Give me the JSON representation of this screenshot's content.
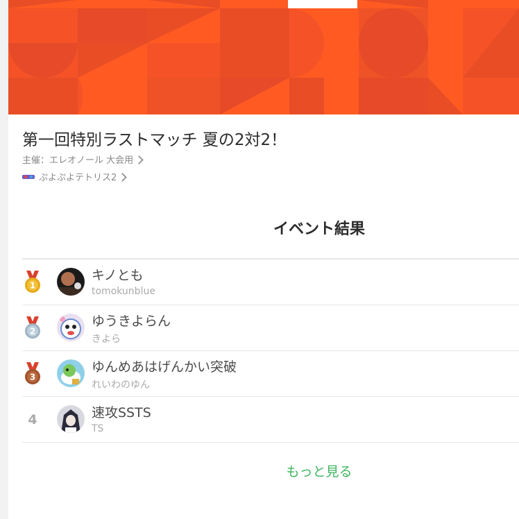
{
  "event": {
    "title": "第一回特別ラストマッチ 夏の2対2！",
    "organizer": "主催：エレオノール 大会用",
    "game": "ぷよぷよテトリス2"
  },
  "results": {
    "heading": "イベント結果",
    "entries": [
      {
        "rank": "1",
        "team": "キノとも",
        "members": "tomokunblue",
        "medal": "gold-medal-icon",
        "medal_color": "#e6a817"
      },
      {
        "rank": "2",
        "team": "ゆうきよらん",
        "members": "きよら",
        "medal": "silver-medal-icon",
        "medal_color": "#9fb4c4"
      },
      {
        "rank": "3",
        "team": "ゆんめあはげんかい突破",
        "members": "れいわのゆん",
        "medal": "bronze-medal-icon",
        "medal_color": "#a0522d"
      },
      {
        "rank": "4",
        "team": "速攻SSTS",
        "members": "TS"
      }
    ],
    "more_label": "もっと見る"
  },
  "colors": {
    "banner": "#ff5a22",
    "accent_green": "#3eb55e",
    "medal_ribbon": "#d9412e"
  }
}
